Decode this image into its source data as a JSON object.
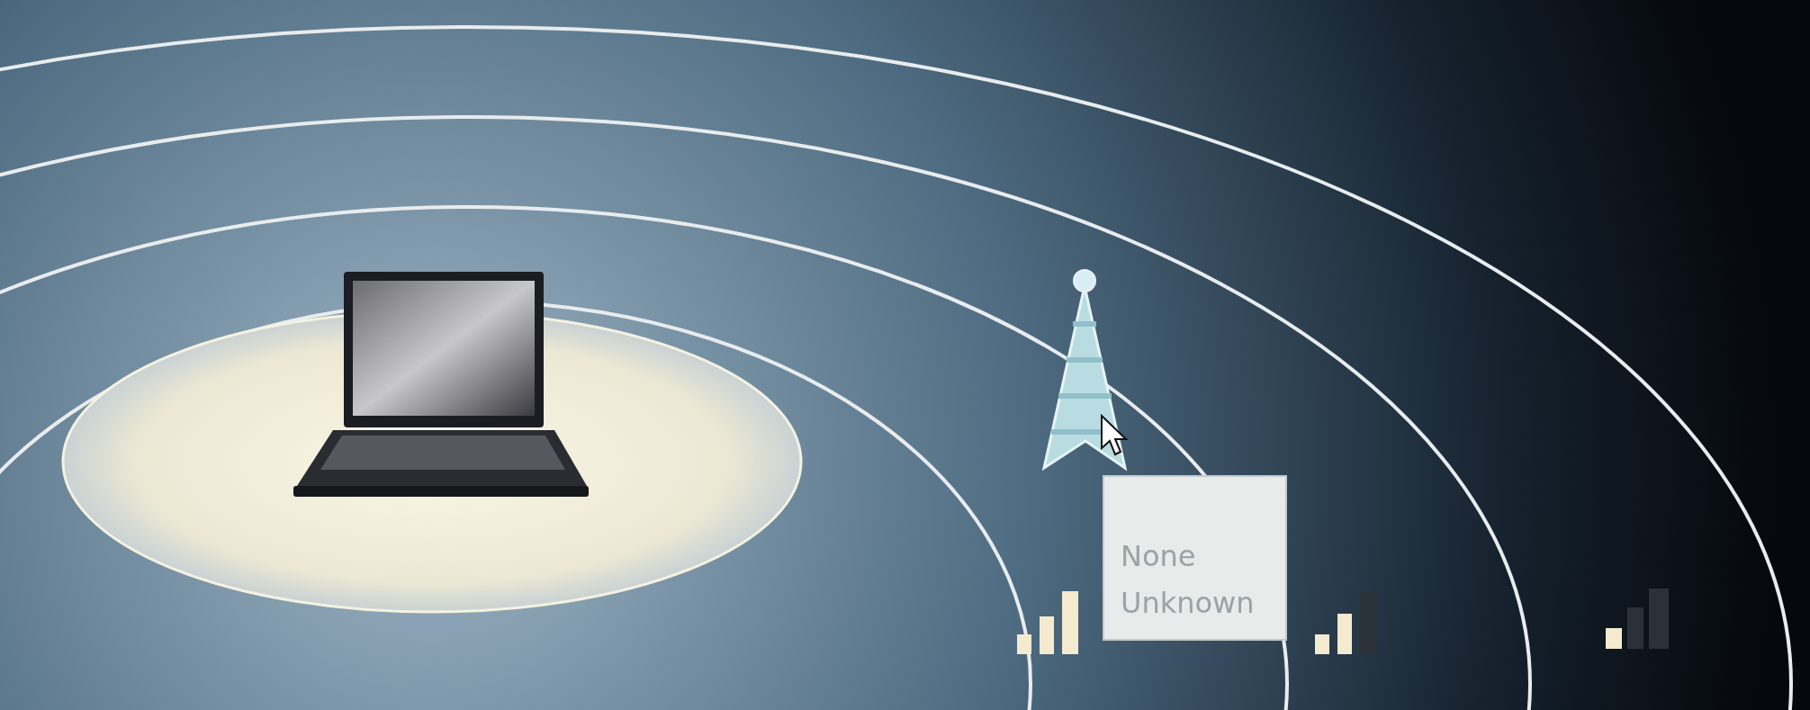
{
  "tooltip": {
    "lines": [
      "None",
      "Unknown"
    ]
  }
}
